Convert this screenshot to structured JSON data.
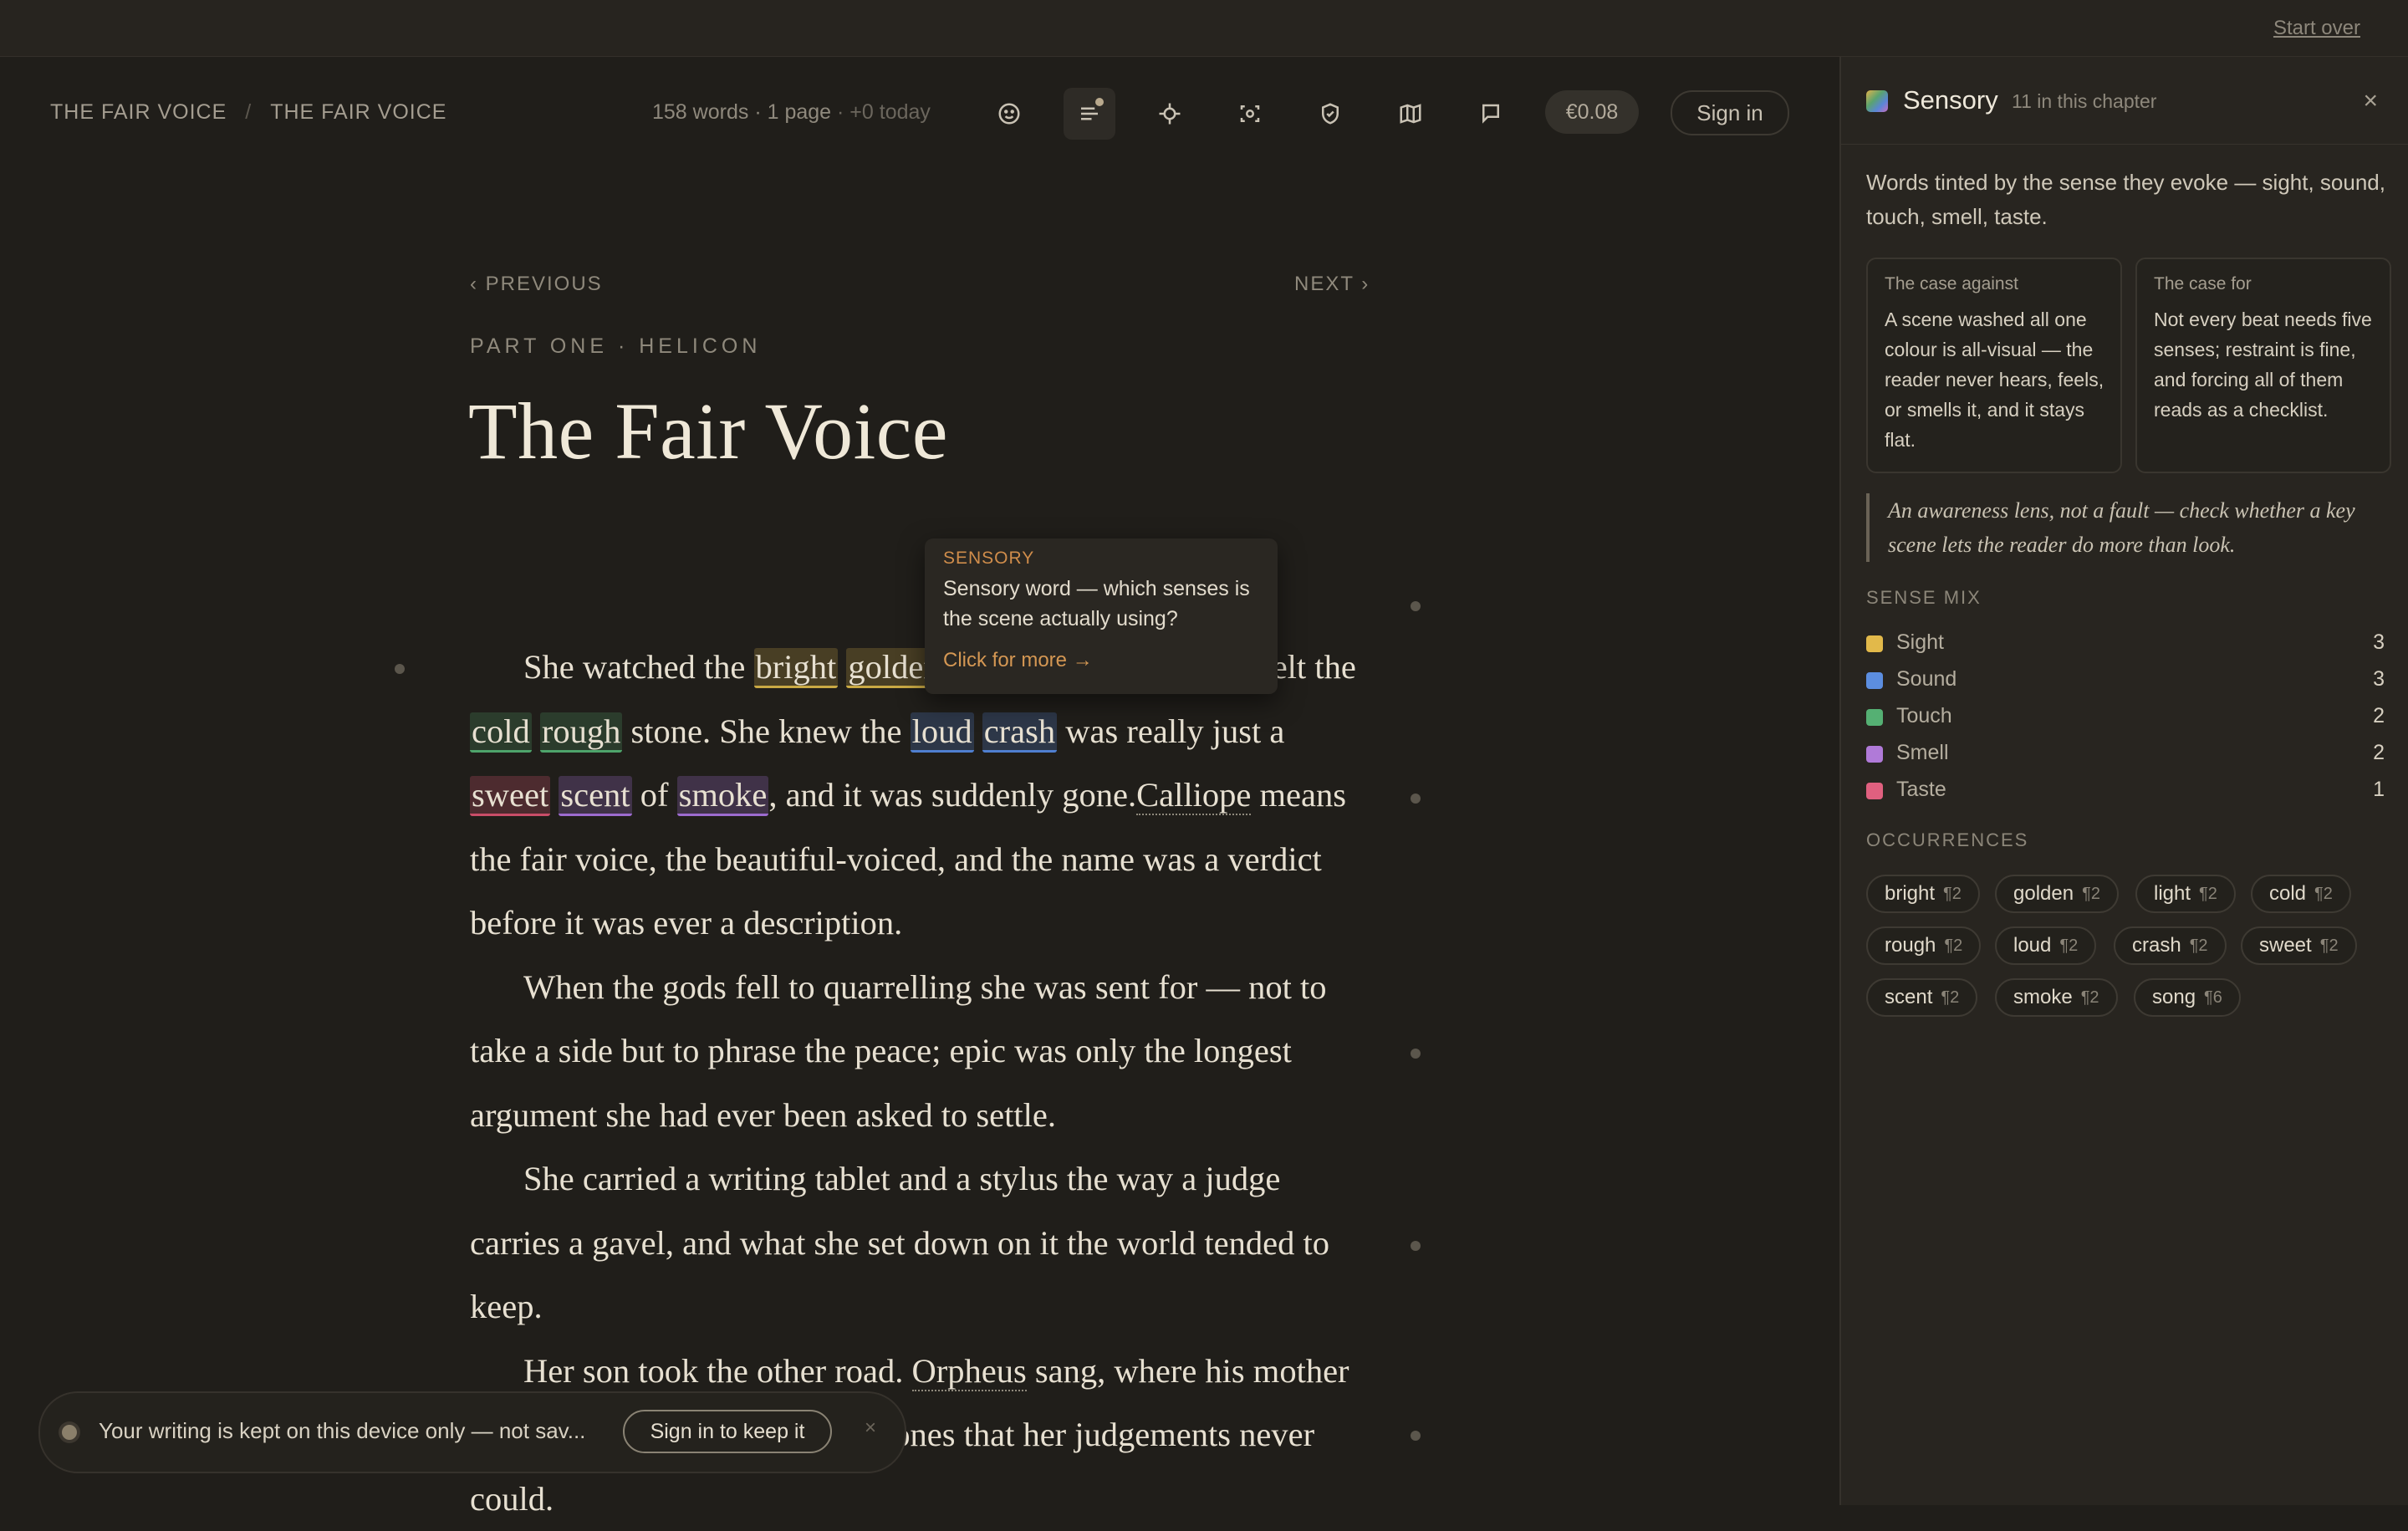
{
  "topbar": {
    "start_over": "Start over"
  },
  "breadcrumb": {
    "book": "THE FAIR VOICE",
    "sep": "/",
    "chapter": "THE FAIR VOICE"
  },
  "stats": {
    "words": "158 words",
    "dot1": "·",
    "pages": "1 page",
    "dot2": "·",
    "today": "+0 today"
  },
  "toolbar_icons": [
    "smile-icon",
    "paragraph-lines-icon",
    "focus-crosshair-icon",
    "scan-icon",
    "shield-check-icon",
    "map-icon",
    "comment-icon"
  ],
  "price": "€0.08",
  "sign_in": "Sign in",
  "nav": {
    "previous": "‹ PREVIOUS",
    "next": "NEXT ›"
  },
  "part_line": "PART ONE · HELICON",
  "title": "The Fair Voice",
  "tooltip": {
    "category": "SENSORY",
    "text": "Sensory word — which senses is the scene actually using?",
    "more": "Click for more →"
  },
  "prose": {
    "p1": {
      "t1": "She watched the ",
      "w_bright": "bright",
      "s1": " ",
      "w_golden": "golden",
      "s2": " ",
      "w_light": "light",
      "t2": " very quietly. She felt the ",
      "w_cold": "cold",
      "s3": " ",
      "w_rough": "rough",
      "t3": " stone. She knew the ",
      "w_loud": "loud",
      "s4": " ",
      "w_crash": "crash",
      "t4": " was really just a ",
      "w_sweet": "sweet",
      "s5": " ",
      "w_scent": "scent",
      "t5": " of ",
      "w_smoke": "smoke",
      "t6": ", and it was suddenly gone.",
      "n_calliope": "Calliope",
      "t7": " means the fair voice, the beautiful-voiced, and the name was a verdict before it was ever a description."
    },
    "p2": "When the gods fell to quarrelling she was sent for — not to take a side but to phrase the peace; epic was only the longest argument she had ever been asked to settle.",
    "p3": "She carried a writing tablet and a stylus the way a judge carries a gavel, and what she set down on it the world tended to keep.",
    "p4": {
      "t1": "Her son took the other road. ",
      "n_orpheus": "Orpheus",
      "t2": " sang, where his mother judged, and his songs moved stones that her judgements never could."
    }
  },
  "toast": {
    "text": "Your writing is kept on this device only — not sav...",
    "button": "Sign in to keep it",
    "close": "×"
  },
  "panel": {
    "title": "Sensory",
    "count": "11 in this chapter",
    "close": "×",
    "description": "Words tinted by the sense they evoke — sight, sound, touch, smell, taste.",
    "case_against": {
      "heading": "The case against",
      "body": "A scene washed all one colour is all-visual — the reader never hears, feels, or smells it, and it stays flat."
    },
    "case_for": {
      "heading": "The case for",
      "body": "Not every beat needs five senses; restraint is fine, and forcing all of them reads as a checklist."
    },
    "quote": "An awareness lens, not a fault — check whether a key scene lets the reader do more than look.",
    "sense_mix_heading": "SENSE MIX",
    "sense_mix": [
      {
        "label": "Sight",
        "count": "3",
        "color": "#e2b94a"
      },
      {
        "label": "Sound",
        "count": "3",
        "color": "#5c8ee0"
      },
      {
        "label": "Touch",
        "count": "2",
        "color": "#55b073"
      },
      {
        "label": "Smell",
        "count": "2",
        "color": "#b07ad8"
      },
      {
        "label": "Taste",
        "count": "1",
        "color": "#e0607f"
      }
    ],
    "occurrences_heading": "OCCURRENCES",
    "occurrences": [
      {
        "word": "bright",
        "ref": "¶2"
      },
      {
        "word": "golden",
        "ref": "¶2"
      },
      {
        "word": "light",
        "ref": "¶2"
      },
      {
        "word": "cold",
        "ref": "¶2"
      },
      {
        "word": "rough",
        "ref": "¶2"
      },
      {
        "word": "loud",
        "ref": "¶2"
      },
      {
        "word": "crash",
        "ref": "¶2"
      },
      {
        "word": "sweet",
        "ref": "¶2"
      },
      {
        "word": "scent",
        "ref": "¶2"
      },
      {
        "word": "smoke",
        "ref": "¶2"
      },
      {
        "word": "song",
        "ref": "¶6"
      }
    ]
  }
}
